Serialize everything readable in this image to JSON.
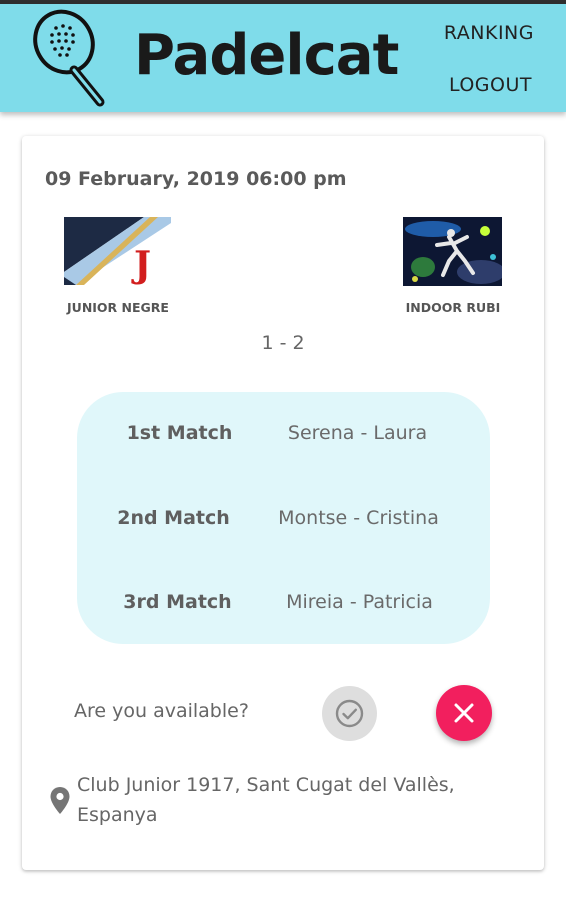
{
  "header": {
    "title": "Padelcat",
    "nav": {
      "ranking": "RANKING",
      "logout": "LOGOUT"
    },
    "background_color": "#7fdcea"
  },
  "card": {
    "date": "09 February, 2019 06:00 pm",
    "home_team": {
      "name": "JUNIOR NEGRE"
    },
    "away_team": {
      "name": "INDOOR RUBI"
    },
    "score": "1 - 2",
    "matches": [
      {
        "label": "1st Match",
        "players": "Serena - Laura"
      },
      {
        "label": "2nd Match",
        "players": "Montse - Cristina"
      },
      {
        "label": "3rd Match",
        "players": "Mireia - Patricia"
      }
    ],
    "availability": {
      "question": "Are you available?",
      "confirm_icon": "check-circle-icon",
      "decline_icon": "close-icon",
      "decline_color": "#f21f5e"
    },
    "location": {
      "icon": "location-pin-icon",
      "address_line1": "Club Junior 1917, Sant Cugat del Vallès,",
      "address_line2": "Espanya"
    }
  }
}
